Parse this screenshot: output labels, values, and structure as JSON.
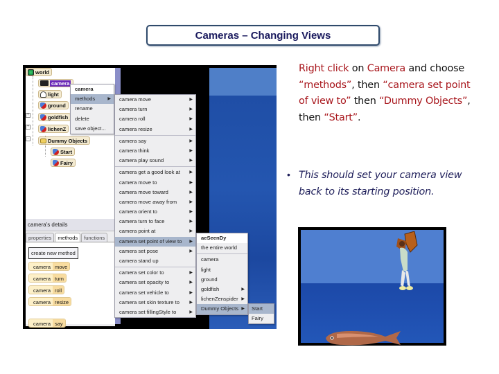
{
  "title": "Cameras – Changing Views",
  "tree": {
    "nodes": [
      {
        "label": "world",
        "icon": "globe-icon"
      },
      {
        "label": "camera",
        "icon": "camera-icon",
        "selected": true
      },
      {
        "label": "light",
        "icon": "light-bulb-icon"
      },
      {
        "label": "ground",
        "icon": "object-icon"
      },
      {
        "label": "goldfish",
        "icon": "object-icon"
      },
      {
        "label": "lichenZ",
        "icon": "object-icon"
      },
      {
        "label": "Dummy Objects",
        "icon": "folder-icon"
      },
      {
        "label": "Start",
        "icon": "object-icon"
      },
      {
        "label": "Fairy",
        "icon": "object-icon"
      }
    ]
  },
  "context_menu": {
    "header": "camera",
    "items": [
      "methods",
      "rename",
      "delete",
      "save object..."
    ],
    "highlighted": "methods"
  },
  "methods_menu": {
    "groups": [
      [
        "camera move",
        "camera turn",
        "camera roll",
        "camera resize"
      ],
      [
        "camera say",
        "camera think",
        "camera play sound"
      ],
      [
        "camera get a good look at",
        "camera move to",
        "camera move  toward",
        "camera move  away from",
        "camera orient to",
        "camera turn to face",
        "camera point at",
        "camera set point of view to",
        "camera set pose",
        "camera stand up"
      ],
      [
        "camera set color to",
        "camera set opacity to",
        "camera set vehicle to",
        "camera set skin texture to",
        "camera set fillingStyle to"
      ]
    ],
    "no_arrow": [
      "camera stand up"
    ],
    "highlighted": "camera set point of view to"
  },
  "target_menu": {
    "header": "aeSeenDy",
    "world_item": "the entire world",
    "items": [
      "camera",
      "light",
      "ground",
      "goldfish",
      "lichenZenspider",
      "Dummy Objects"
    ],
    "with_arrow": [
      "goldfish",
      "lichenZenspider",
      "Dummy Objects"
    ],
    "highlighted": "Dummy Objects"
  },
  "dummy_menu": {
    "items": [
      "Start",
      "Fairy"
    ],
    "highlighted": "Start"
  },
  "details": {
    "header": "camera's details",
    "tabs": [
      "properties",
      "methods",
      "functions"
    ],
    "active_tab": "methods",
    "create_button": "create new method",
    "tiles": [
      {
        "object": "camera",
        "method": "move"
      },
      {
        "object": "camera",
        "method": "turn"
      },
      {
        "object": "camera",
        "method": "roll"
      },
      {
        "object": "camera",
        "method": "resize"
      },
      {
        "object": "camera",
        "method": "say"
      }
    ]
  },
  "instructions": {
    "p1": [
      {
        "text": "Right click",
        "red": true
      },
      {
        "text": " on ",
        "red": false
      },
      {
        "text": "Camera",
        "red": true
      },
      {
        "text": " and choose ",
        "red": false
      },
      {
        "text": "“methods”",
        "red": true
      },
      {
        "text": ", then ",
        "red": false
      },
      {
        "text": "“camera set point of view to”",
        "red": true
      },
      {
        "text": " then ",
        "red": false
      },
      {
        "text": "“Dummy Objects”",
        "red": true
      },
      {
        "text": ", then ",
        "red": false
      },
      {
        "text": "“Start”",
        "red": true
      },
      {
        "text": ".",
        "red": false
      }
    ],
    "bullet": "•",
    "p2": "This should set your camera view back to its starting position."
  },
  "colors": {
    "title_text": "#1a1a5e",
    "accent_red": "#a8161c",
    "menu_highlight": "#a8b6cc",
    "selection_purple": "#6a28b8"
  }
}
